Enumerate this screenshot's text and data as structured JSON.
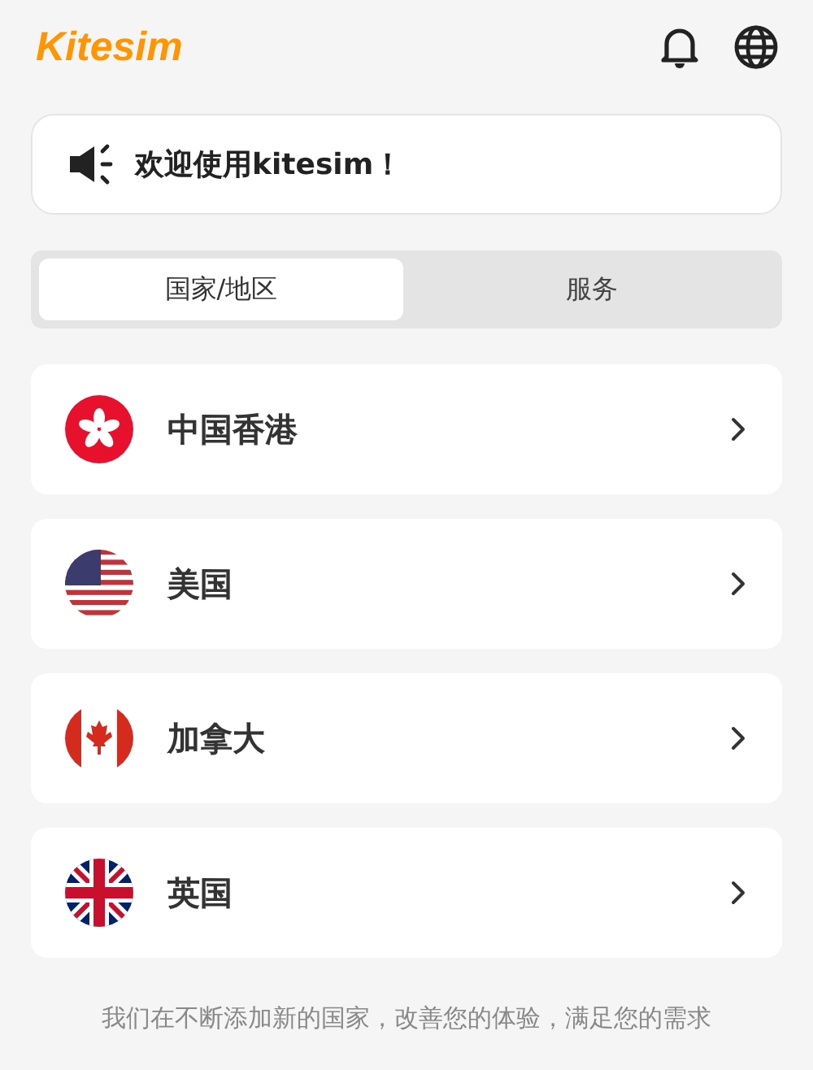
{
  "logo": "Kitesim",
  "notice": "欢迎使用kitesim！",
  "tabs": [
    {
      "label": "国家/地区",
      "selected": true
    },
    {
      "label": "服务",
      "selected": false
    }
  ],
  "regions": [
    {
      "name": "中国香港",
      "kind": "hk"
    },
    {
      "name": "美国",
      "kind": "us"
    },
    {
      "name": "加拿大",
      "kind": "ca"
    },
    {
      "name": "英国",
      "kind": "gb"
    }
  ],
  "footer": "我们在不断添加新的国家，改善您的体验，满足您的需求"
}
